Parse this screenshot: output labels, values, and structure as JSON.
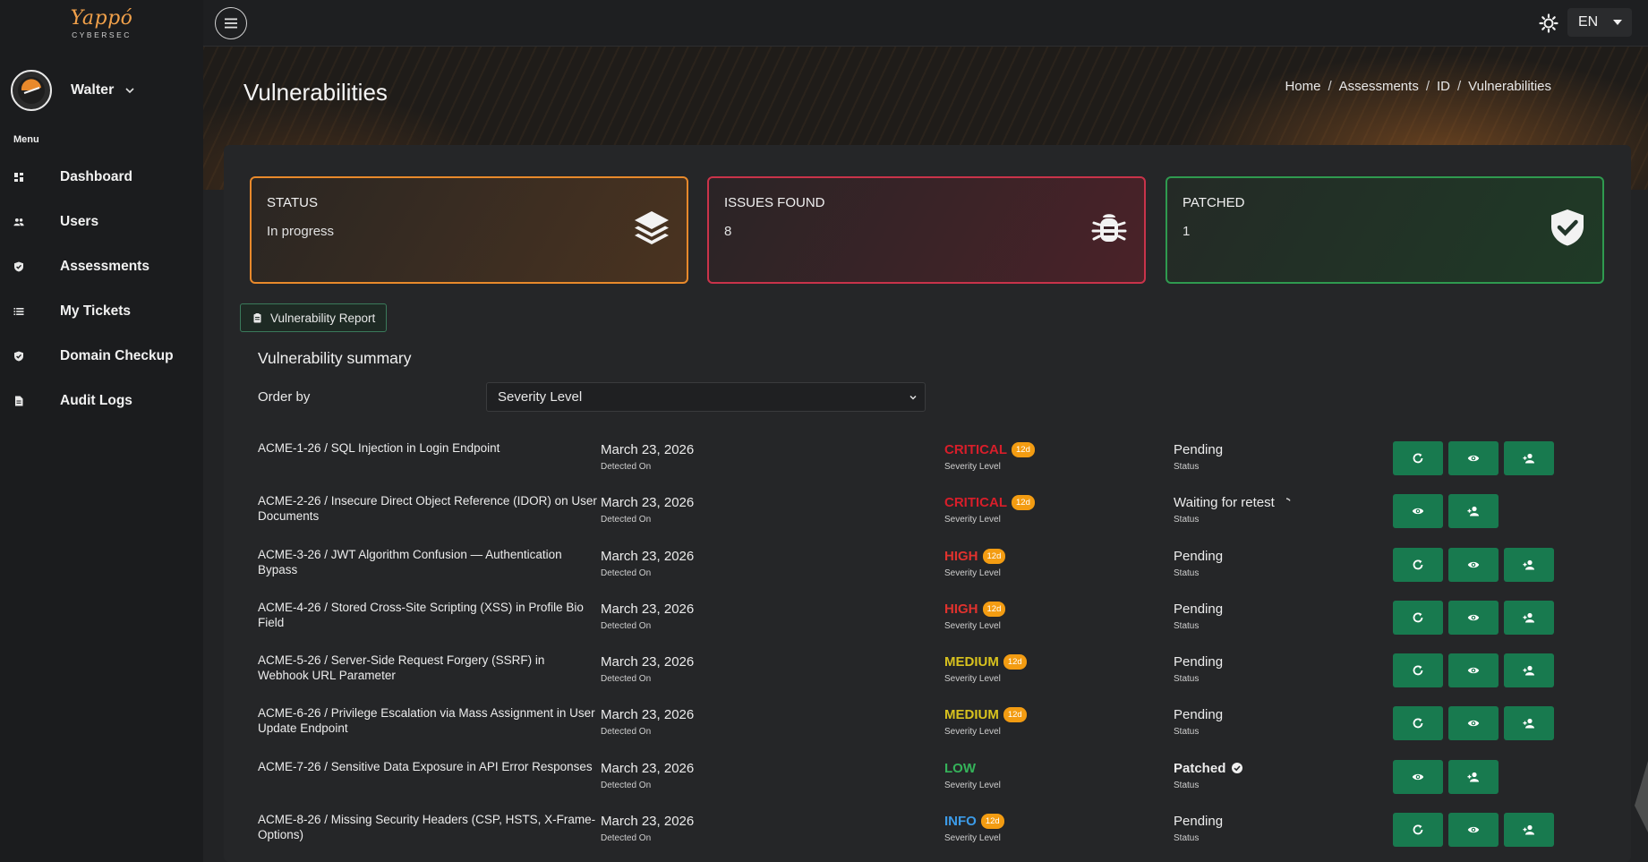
{
  "brand": {
    "name": "Yappó",
    "tagline": "CYBERSEC"
  },
  "user": {
    "name": "Walter"
  },
  "sidebar": {
    "menu_label": "Menu",
    "items": [
      {
        "label": "Dashboard",
        "icon": "dashboard-icon"
      },
      {
        "label": "Users",
        "icon": "users-icon"
      },
      {
        "label": "Assessments",
        "icon": "shield-check-icon"
      },
      {
        "label": "My Tickets",
        "icon": "list-icon"
      },
      {
        "label": "Domain Checkup",
        "icon": "shield-check-icon"
      },
      {
        "label": "Audit Logs",
        "icon": "document-icon"
      }
    ]
  },
  "topbar": {
    "language": "EN"
  },
  "page": {
    "title": "Vulnerabilities",
    "breadcrumb": [
      "Home",
      "Assessments",
      "ID",
      "Vulnerabilities"
    ]
  },
  "stats": [
    {
      "label": "STATUS",
      "value": "In progress",
      "icon": "layers-icon",
      "color": "#e8892b"
    },
    {
      "label": "ISSUES FOUND",
      "value": "8",
      "icon": "bug-icon",
      "color": "#c9334a"
    },
    {
      "label": "PATCHED",
      "value": "1",
      "icon": "shield-check-icon",
      "color": "#2f9a4f"
    }
  ],
  "report_button": {
    "label": "Vulnerability Report"
  },
  "summary": {
    "title": "Vulnerability summary",
    "order_label": "Order by",
    "order_value": "Severity Level",
    "sub_labels": {
      "date": "Detected On",
      "severity": "Severity Level",
      "status": "Status"
    }
  },
  "vulnerabilities": [
    {
      "title": "ACME-1-26 / SQL Injection in Login Endpoint",
      "date": "March 23, 2026",
      "severity": "CRITICAL",
      "age": "12d",
      "status": "Pending"
    },
    {
      "title": "ACME-2-26 / Insecure Direct Object Reference (IDOR) on User Documents",
      "date": "March 23, 2026",
      "severity": "CRITICAL",
      "age": "12d",
      "status": "Waiting for retest"
    },
    {
      "title": "ACME-3-26 / JWT Algorithm Confusion — Authentication Bypass",
      "date": "March 23, 2026",
      "severity": "HIGH",
      "age": "12d",
      "status": "Pending"
    },
    {
      "title": "ACME-4-26 / Stored Cross-Site Scripting (XSS) in Profile Bio Field",
      "date": "March 23, 2026",
      "severity": "HIGH",
      "age": "12d",
      "status": "Pending"
    },
    {
      "title": "ACME-5-26 / Server-Side Request Forgery (SSRF) in Webhook URL Parameter",
      "date": "March 23, 2026",
      "severity": "MEDIUM",
      "age": "12d",
      "status": "Pending"
    },
    {
      "title": "ACME-6-26 / Privilege Escalation via Mass Assignment in User Update Endpoint",
      "date": "March 23, 2026",
      "severity": "MEDIUM",
      "age": "12d",
      "status": "Pending"
    },
    {
      "title": "ACME-7-26 / Sensitive Data Exposure in API Error Responses",
      "date": "March 23, 2026",
      "severity": "LOW",
      "age": "",
      "status": "Patched"
    },
    {
      "title": "ACME-8-26 / Missing Security Headers (CSP, HSTS, X-Frame-Options)",
      "date": "March 23, 2026",
      "severity": "INFO",
      "age": "12d",
      "status": "Pending"
    }
  ],
  "colors": {
    "critical": "#d81e2a",
    "high": "#e0322e",
    "medium": "#d8c21e",
    "low": "#35b35a",
    "info": "#3c9be8",
    "action_button": "#187a4f",
    "age_badge": "#f39c12"
  }
}
